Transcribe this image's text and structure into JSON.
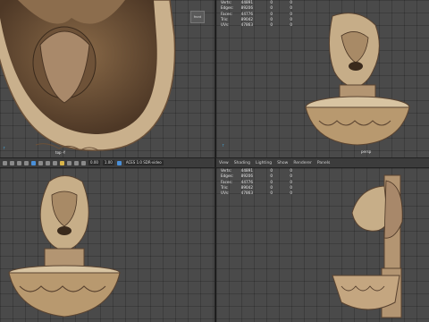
{
  "toolbar_bottom_left": {
    "field_a": "0.00",
    "field_b": "1.00",
    "gamma": "ACES 1.0 SDR-video"
  },
  "toolbar_bottom_right": {
    "menu": [
      "View",
      "Shading",
      "Lighting",
      "Show",
      "Renderer",
      "Panels"
    ]
  },
  "top_left": {
    "camera_label": "top -Y",
    "button_label": "front"
  },
  "top_right": {
    "camera_label": "persp",
    "stats": [
      {
        "label": "Verts:",
        "v1": "44891",
        "v2": "0",
        "v3": "0"
      },
      {
        "label": "Edges:",
        "v1": "89206",
        "v2": "0",
        "v3": "0"
      },
      {
        "label": "Faces:",
        "v1": "44776",
        "v2": "0",
        "v3": "0"
      },
      {
        "label": "Tris:",
        "v1": "89042",
        "v2": "0",
        "v3": "0"
      },
      {
        "label": "UVs:",
        "v1": "47863",
        "v2": "0",
        "v3": "0"
      }
    ]
  },
  "bottom_right": {
    "stats": [
      {
        "label": "Verts:",
        "v1": "44891",
        "v2": "0",
        "v3": "0"
      },
      {
        "label": "Edges:",
        "v1": "89206",
        "v2": "0",
        "v3": "0"
      },
      {
        "label": "Faces:",
        "v1": "44776",
        "v2": "0",
        "v3": "0"
      },
      {
        "label": "Tris:",
        "v1": "89042",
        "v2": "0",
        "v3": "0"
      },
      {
        "label": "UVs:",
        "v1": "47863",
        "v2": "0",
        "v3": "0"
      }
    ]
  },
  "colors": {
    "stone_light": "#d6c2a2",
    "stone_mid": "#a98a63",
    "stone_dark": "#5a4330",
    "viewport": "#4a4a4a"
  }
}
